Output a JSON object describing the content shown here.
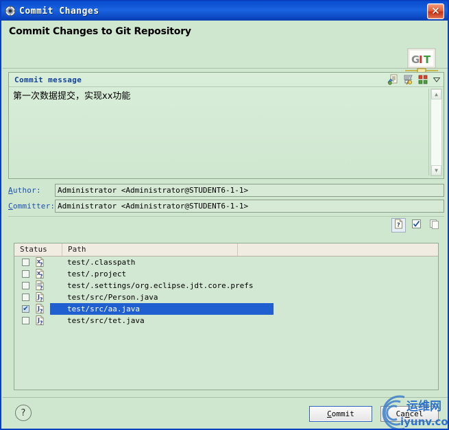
{
  "window": {
    "title": "Commit Changes",
    "title_icon": "gear-icon",
    "close_label": "✕"
  },
  "header": {
    "title": "Commit Changes to Git Repository",
    "logo_text": "GIT",
    "logo_letters": [
      "G",
      "I",
      "T"
    ]
  },
  "commit_message": {
    "group_label": "Commit message",
    "text": "第一次数据提交，实现xx功能",
    "tools": [
      {
        "name": "add-signed-off-by-icon",
        "title": "Add Signed-off-by"
      },
      {
        "name": "add-change-id-icon",
        "title": "Add Change-Id"
      },
      {
        "name": "amend-commit-icon",
        "title": "Amend Previous Commit"
      },
      {
        "name": "chevron-down-icon",
        "title": "More"
      }
    ],
    "scroll_up": "▲",
    "scroll_down": "▼"
  },
  "fields": {
    "author": {
      "label": "Author:",
      "label_mnemonic": "A",
      "value": "Administrator <Administrator@STUDENT6-1-1>"
    },
    "committer": {
      "label": "Committer:",
      "label_mnemonic": "C",
      "value": "Administrator <Administrator@STUDENT6-1-1>"
    }
  },
  "table_toolbar": {
    "buttons": [
      {
        "name": "show-untracked-files-button",
        "icon": "document-question-icon",
        "pressed": true
      },
      {
        "name": "select-all-button",
        "icon": "checkbox-checked-icon",
        "pressed": false
      },
      {
        "name": "deselect-all-button",
        "icon": "copy-blank-icon",
        "pressed": false
      }
    ]
  },
  "file_table": {
    "columns": [
      "Status",
      "Path"
    ],
    "rows": [
      {
        "checked": false,
        "selected": false,
        "icon": "file-xml-untracked-icon",
        "path": "test/.classpath"
      },
      {
        "checked": false,
        "selected": false,
        "icon": "file-xml-untracked-icon",
        "path": "test/.project"
      },
      {
        "checked": false,
        "selected": false,
        "icon": "file-prefs-untracked-icon",
        "path": "test/.settings/org.eclipse.jdt.core.prefs"
      },
      {
        "checked": false,
        "selected": false,
        "icon": "file-java-untracked-icon",
        "path": "test/src/Person.java"
      },
      {
        "checked": true,
        "selected": true,
        "icon": "file-java-untracked-icon",
        "path": "test/src/aa.java"
      },
      {
        "checked": false,
        "selected": false,
        "icon": "file-java-untracked-icon",
        "path": "test/src/tet.java"
      }
    ]
  },
  "footer": {
    "help_label": "?",
    "commit": {
      "label": "Commit",
      "mnemonic": "C"
    },
    "cancel": {
      "label": "Cancel",
      "mnemonic": "n"
    }
  },
  "watermark": {
    "cn_text": "运维网",
    "en_text": "iyunv.com",
    "color": "#2f72c9"
  },
  "colors": {
    "dialog_background": "#cfe6cf",
    "titlebar_blue": "#0b55d6",
    "accent_label_blue": "#1a4fb0",
    "selection_blue": "#1f5fd0",
    "table_header": "#f0ece1"
  }
}
